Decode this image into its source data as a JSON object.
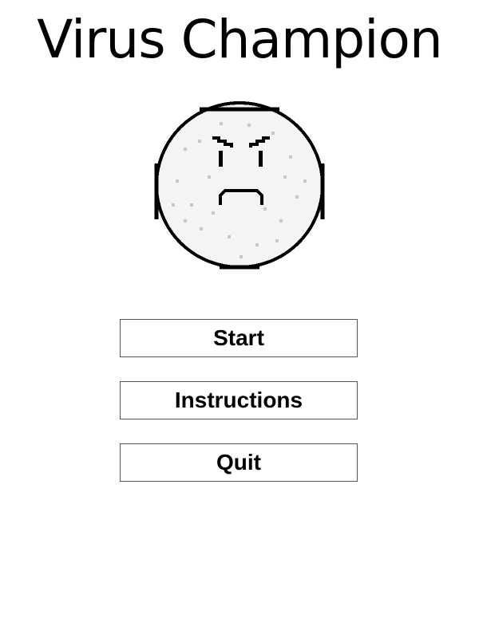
{
  "game": {
    "title": "Virus Champion"
  },
  "menu": {
    "start_label": "Start",
    "instructions_label": "Instructions",
    "quit_label": "Quit"
  },
  "mascot": {
    "icon": "angry-virus-face-icon",
    "outline_color": "#000000",
    "fill_color": "#f4f4f4",
    "speckle_color": "#c8c8c8"
  }
}
